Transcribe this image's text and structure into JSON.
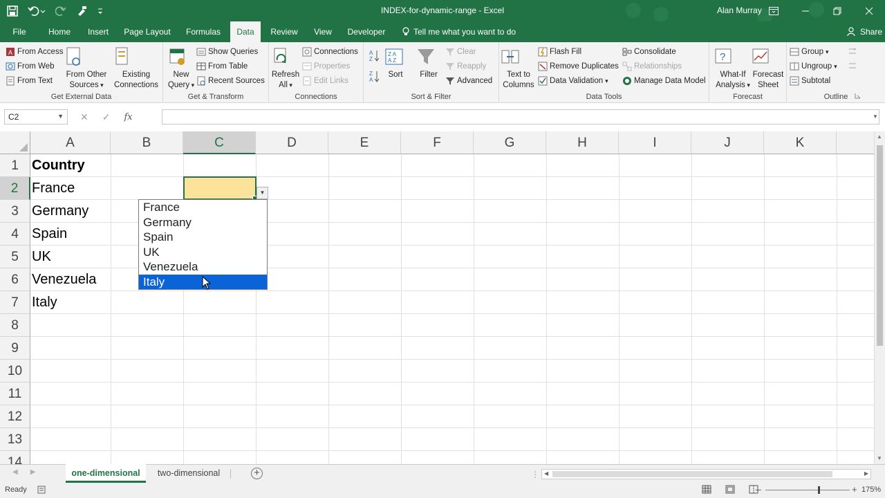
{
  "window": {
    "title": "INDEX-for-dynamic-range  -  Excel",
    "user": "Alan Murray"
  },
  "colors": {
    "accent": "#217346",
    "selected_fill": "#fde29b",
    "list_highlight": "#0a64d8"
  },
  "tabs": {
    "file": "File",
    "home": "Home",
    "insert": "Insert",
    "page_layout": "Page Layout",
    "formulas": "Formulas",
    "data": "Data",
    "review": "Review",
    "view": "View",
    "developer": "Developer",
    "tell_me": "Tell me what you want to do",
    "share": "Share"
  },
  "ribbon": {
    "get_external": {
      "label": "Get External Data",
      "from_access": "From Access",
      "from_web": "From Web",
      "from_text": "From Text",
      "from_other_1": "From Other",
      "from_other_2": "Sources",
      "existing_1": "Existing",
      "existing_2": "Connections"
    },
    "get_transform": {
      "label": "Get & Transform",
      "new_query_1": "New",
      "new_query_2": "Query",
      "show_queries": "Show Queries",
      "from_table": "From Table",
      "recent_sources": "Recent Sources"
    },
    "connections": {
      "label": "Connections",
      "refresh_1": "Refresh",
      "refresh_2": "All",
      "connections": "Connections",
      "properties": "Properties",
      "edit_links": "Edit Links"
    },
    "sort_filter": {
      "label": "Sort & Filter",
      "sort": "Sort",
      "filter": "Filter",
      "clear": "Clear",
      "reapply": "Reapply",
      "advanced": "Advanced"
    },
    "data_tools": {
      "label": "Data Tools",
      "text_to_1": "Text to",
      "text_to_2": "Columns",
      "flash_fill": "Flash Fill",
      "remove_duplicates": "Remove Duplicates",
      "data_validation": "Data Validation",
      "consolidate": "Consolidate",
      "relationships": "Relationships",
      "manage_model": "Manage Data Model"
    },
    "forecast": {
      "label": "Forecast",
      "what_if_1": "What-If",
      "what_if_2": "Analysis",
      "sheet_1": "Forecast",
      "sheet_2": "Sheet"
    },
    "outline": {
      "label": "Outline",
      "group": "Group",
      "ungroup": "Ungroup",
      "subtotal": "Subtotal"
    }
  },
  "formula_bar": {
    "name_box": "C2",
    "fx": "fx",
    "formula": ""
  },
  "columns": [
    "A",
    "B",
    "C",
    "D",
    "E",
    "F",
    "G",
    "H",
    "I",
    "J",
    "K"
  ],
  "rows": [
    "1",
    "2",
    "3",
    "4",
    "5",
    "6",
    "7",
    "8",
    "9",
    "10",
    "11",
    "12",
    "13",
    "14"
  ],
  "cells": {
    "a1": "Country",
    "a2": "France",
    "a3": "Germany",
    "a4": "Spain",
    "a5": "UK",
    "a6": "Venezuela",
    "a7": "Italy"
  },
  "dropdown": {
    "options": [
      "France",
      "Germany",
      "Spain",
      "UK",
      "Venezuela",
      "Italy"
    ],
    "highlighted": "Italy"
  },
  "sheets": {
    "active": "one-dimensional",
    "other": "two-dimensional"
  },
  "status": {
    "ready": "Ready",
    "zoom": "175%"
  }
}
